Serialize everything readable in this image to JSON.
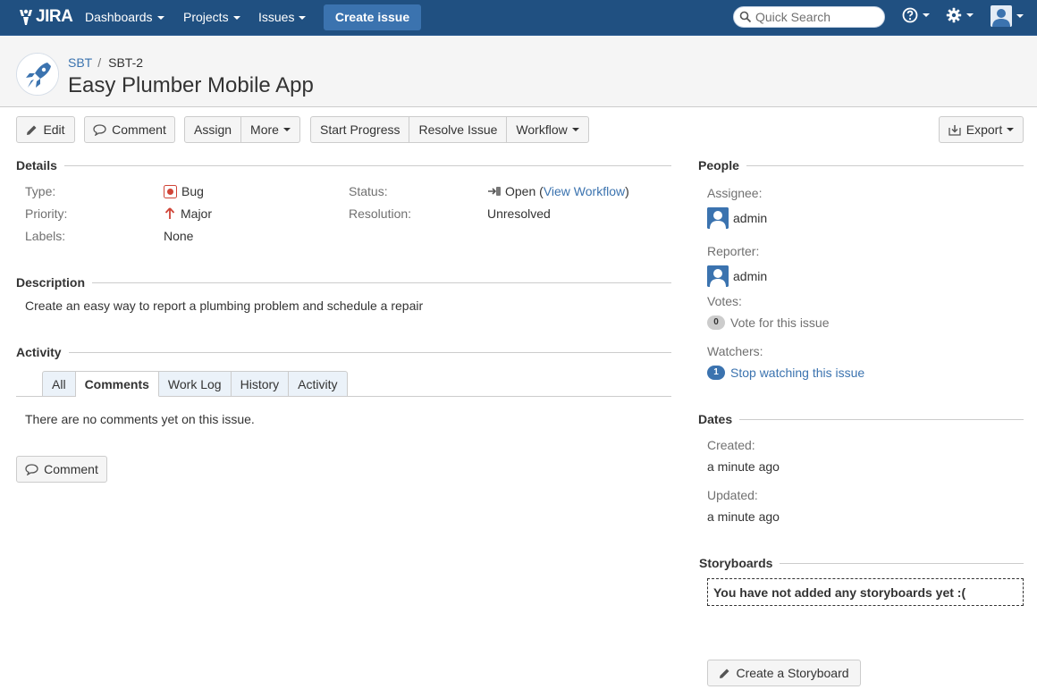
{
  "nav": {
    "logo_text": "JIRA",
    "dashboards": "Dashboards",
    "projects": "Projects",
    "issues": "Issues",
    "create": "Create issue",
    "search_placeholder": "Quick Search"
  },
  "header": {
    "project_key": "SBT",
    "separator": "/",
    "issue_key": "SBT-2",
    "summary": "Easy Plumber Mobile App"
  },
  "toolbar": {
    "edit": "Edit",
    "comment": "Comment",
    "assign": "Assign",
    "more": "More",
    "start_progress": "Start Progress",
    "resolve_issue": "Resolve Issue",
    "workflow": "Workflow",
    "export": "Export"
  },
  "details": {
    "heading": "Details",
    "type_label": "Type:",
    "type_value": "Bug",
    "priority_label": "Priority:",
    "priority_value": "Major",
    "labels_label": "Labels:",
    "labels_value": "None",
    "status_label": "Status:",
    "status_value": "Open",
    "status_open_paren": "(",
    "status_link": "View Workflow",
    "status_close_paren": ")",
    "resolution_label": "Resolution:",
    "resolution_value": "Unresolved"
  },
  "description": {
    "heading": "Description",
    "text": "Create an easy way to report a plumbing problem and schedule a repair"
  },
  "activity": {
    "heading": "Activity",
    "tabs": [
      "All",
      "Comments",
      "Work Log",
      "History",
      "Activity"
    ],
    "active_tab": "Comments",
    "empty_text": "There are no comments yet on this issue.",
    "comment_button": "Comment"
  },
  "people": {
    "heading": "People",
    "assignee_label": "Assignee:",
    "assignee": "admin",
    "reporter_label": "Reporter:",
    "reporter": "admin",
    "votes_label": "Votes:",
    "votes_count": "0",
    "vote_text": "Vote for this issue",
    "watchers_label": "Watchers:",
    "watchers_count": "1",
    "watch_text": "Stop watching this issue"
  },
  "dates": {
    "heading": "Dates",
    "created_label": "Created:",
    "created": "a minute ago",
    "updated_label": "Updated:",
    "updated": "a minute ago"
  },
  "storyboards": {
    "heading": "Storyboards",
    "empty_text": "You have not added any storyboards yet :(",
    "create_button": "Create a Storyboard"
  },
  "colors": {
    "nav_bg": "#205081",
    "accent": "#3b73af",
    "bug_red": "#d04437"
  },
  "icons": {
    "help": "help-icon",
    "settings": "gear-icon",
    "user": "user-avatar-icon"
  }
}
